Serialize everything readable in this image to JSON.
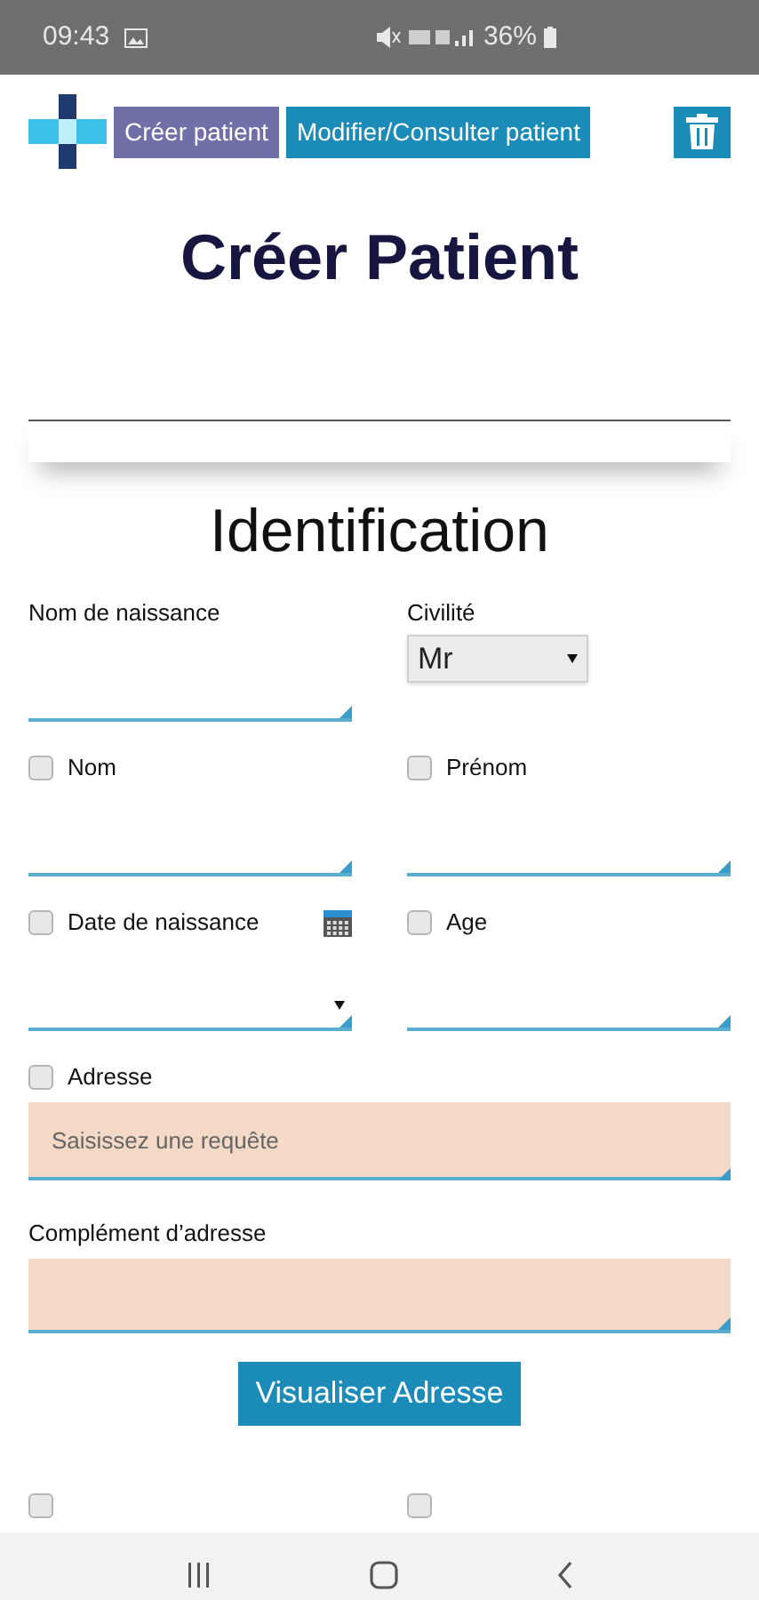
{
  "status_bar": {
    "time": "09:43",
    "battery": "36%"
  },
  "nav": {
    "tabs": [
      {
        "label": "Créer patient",
        "selected": true
      },
      {
        "label": "Modifier/Consulter patient",
        "selected": false
      }
    ]
  },
  "page_title": "Créer Patient",
  "section_title": "Identification",
  "rows": [
    [
      {
        "kind": "text",
        "label": "Nom de naissance"
      },
      {
        "kind": "select",
        "label": "Civilité",
        "value": "Mr"
      }
    ],
    [
      {
        "kind": "text",
        "label": "Nom",
        "checked": false
      },
      {
        "kind": "text",
        "label": "Prénom",
        "checked": false
      }
    ],
    [
      {
        "kind": "date",
        "label": "Date de naissance",
        "checked": false
      },
      {
        "kind": "text",
        "label": "Age",
        "checked": false
      }
    ]
  ],
  "address": {
    "label": "Adresse",
    "checked": false,
    "placeholder": "Saisissez une requête"
  },
  "complement": {
    "label": "Complément d’adresse"
  },
  "visualize_button": "Visualiser Adresse",
  "more_checkboxes": [
    {
      "checked": false
    },
    {
      "checked": false
    }
  ]
}
